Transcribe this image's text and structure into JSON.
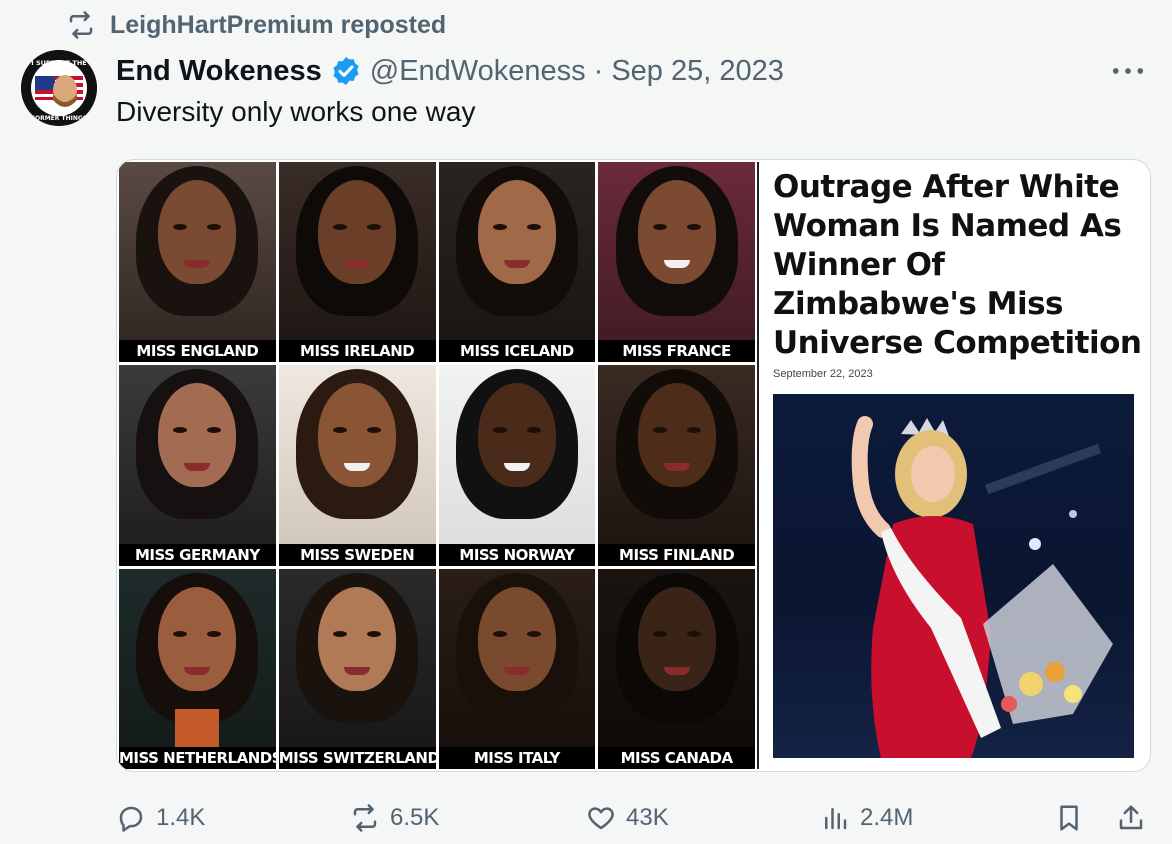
{
  "repost": {
    "text": "LeighHartPremium reposted"
  },
  "author": {
    "display_name": "End Wokeness",
    "handle": "@EndWokeness",
    "separator": "·",
    "date": "Sep 25, 2023",
    "avatar_text_top": "I SUPPORT THE",
    "avatar_text_bottom": "FORMER THINGS"
  },
  "tweet": {
    "text": "Diversity only works one way"
  },
  "media": {
    "tiles": [
      {
        "label": "MISS ENGLAND"
      },
      {
        "label": "MISS IRELAND"
      },
      {
        "label": "MISS ICELAND"
      },
      {
        "label": "MISS FRANCE"
      },
      {
        "label": "MISS GERMANY"
      },
      {
        "label": "MISS SWEDEN"
      },
      {
        "label": "MISS NORWAY"
      },
      {
        "label": "MISS FINLAND"
      },
      {
        "label": "MISS NETHERLANDS"
      },
      {
        "label": "MISS SWITZERLAND"
      },
      {
        "label": "MISS ITALY"
      },
      {
        "label": "MISS CANADA"
      }
    ],
    "article": {
      "headline": "Outrage After White Woman Is Named As Winner Of Zimbabwe's Miss Universe Competition",
      "date": "September 22, 2023"
    }
  },
  "actions": {
    "reply": "1.4K",
    "repost": "6.5K",
    "like": "43K",
    "views": "2.4M"
  },
  "colors": {
    "secondary_text": "#536471",
    "verified_blue": "#1d9bf0",
    "background": "#f5f6f6",
    "border": "#cfd9de"
  }
}
